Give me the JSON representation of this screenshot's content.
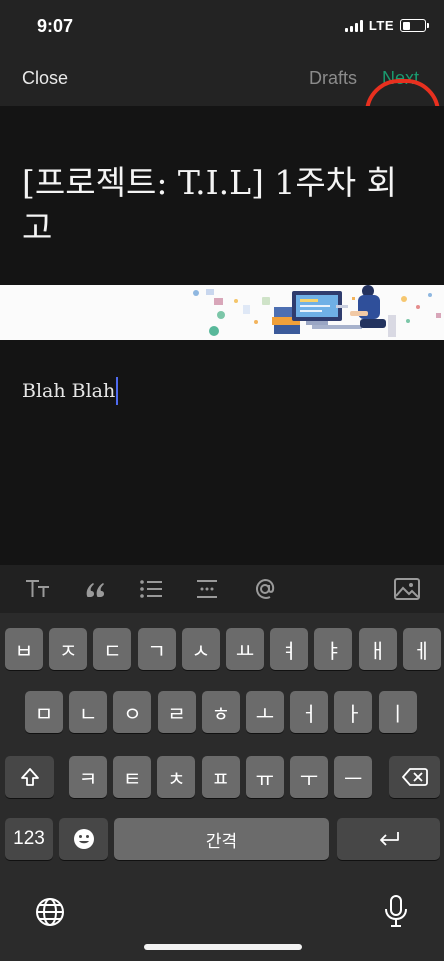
{
  "status_bar": {
    "time": "9:07",
    "network": "LTE",
    "battery_level": 0.35
  },
  "nav": {
    "close_label": "Close",
    "drafts_label": "Drafts",
    "next_label": "Next",
    "next_color": "#1a9a6f",
    "highlight_color": "#e8301f"
  },
  "post": {
    "title": "[프로젝트: T.I.L] 1주차 회고",
    "body": "Blah Blah"
  },
  "format_toolbar": {
    "items": [
      "text-size-icon",
      "quote-icon",
      "list-icon",
      "separator-icon",
      "mention-icon",
      "image-icon"
    ]
  },
  "keyboard": {
    "row1": [
      "ㅂ",
      "ㅈ",
      "ㄷ",
      "ㄱ",
      "ㅅ",
      "ㅛ",
      "ㅕ",
      "ㅑ",
      "ㅐ",
      "ㅔ"
    ],
    "row2": [
      "ㅁ",
      "ㄴ",
      "ㅇ",
      "ㄹ",
      "ㅎ",
      "ㅗ",
      "ㅓ",
      "ㅏ",
      "ㅣ"
    ],
    "row3": [
      "ㅋ",
      "ㅌ",
      "ㅊ",
      "ㅍ",
      "ㅠ",
      "ㅜ",
      "ㅡ"
    ],
    "numbers_label": "123",
    "space_label": "간격"
  }
}
